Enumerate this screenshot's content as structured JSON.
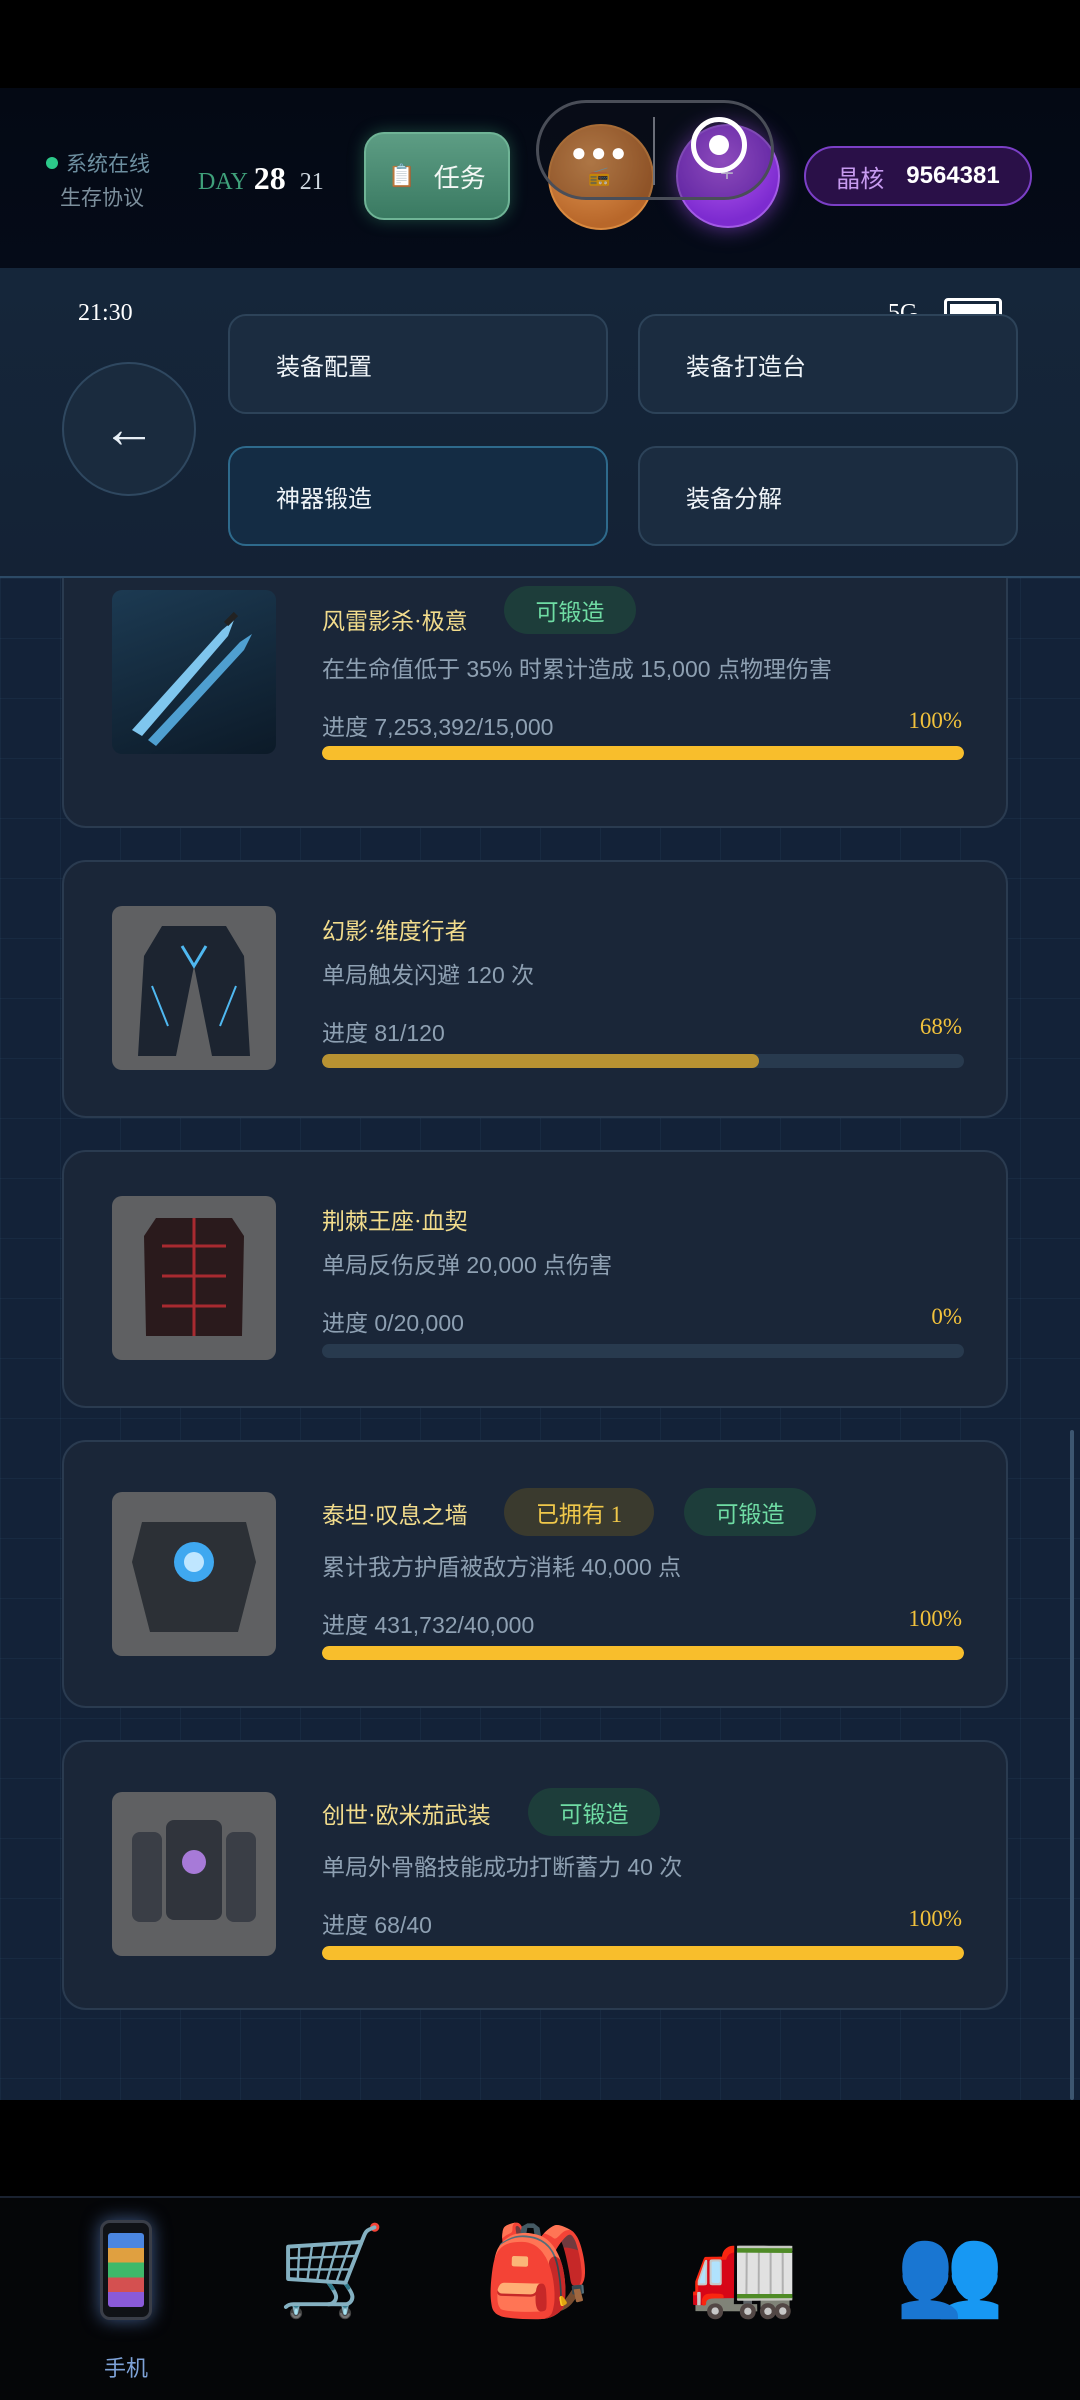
{
  "hud": {
    "online_status": "系统在线",
    "protocol": "生存协议",
    "day_label": "DAY",
    "day_number": "28",
    "day_sub": "21",
    "task_button": "任务",
    "crystal_label": "晶核",
    "crystal_value": "9564381",
    "status_dot_color": "#2cc98a"
  },
  "status_bar": {
    "time": "21:30",
    "network": "5G"
  },
  "nav": {
    "back_glyph": "←",
    "buttons": [
      {
        "label": "装备配置",
        "active": false
      },
      {
        "label": "装备打造台",
        "active": false
      },
      {
        "label": "神器锻造",
        "active": true
      },
      {
        "label": "装备分解",
        "active": false
      }
    ]
  },
  "items": [
    {
      "title": "风雷影杀·极意",
      "tags": [
        "可锻造"
      ],
      "desc": "在生命值低于 35% 时累计造成 15,000 点物理伤害",
      "progress_text": "进度 7,253,392/15,000",
      "percent_text": "100%",
      "percent": 1.0,
      "icon": "twin-blades-icon"
    },
    {
      "title": "幻影·维度行者",
      "tags": [],
      "desc": "单局触发闪避 120 次",
      "progress_text": "进度 81/120",
      "percent_text": "68%",
      "percent": 0.68,
      "icon": "tech-coat-icon"
    },
    {
      "title": "荆棘王座·血契",
      "tags": [],
      "desc": "单局反伤反弹 20,000 点伤害",
      "progress_text": "进度 0/20,000",
      "percent_text": "0%",
      "percent": 0.0,
      "icon": "spiked-vest-icon"
    },
    {
      "title": "泰坦·叹息之墙",
      "tags": [
        "已拥有 1",
        "可锻造"
      ],
      "desc": "累计我方护盾被敌方消耗 40,000 点",
      "progress_text": "进度 431,732/40,000",
      "percent_text": "100%",
      "percent": 1.0,
      "icon": "titan-armor-icon"
    },
    {
      "title": "创世·欧米茄武装",
      "tags": [
        "可锻造"
      ],
      "desc": "单局外骨骼技能成功打断蓄力 40 次",
      "progress_text": "进度 68/40",
      "percent_text": "100%",
      "percent": 1.0,
      "icon": "exoskeleton-icon"
    }
  ],
  "tabbar": {
    "tabs": [
      {
        "label": "手机",
        "icon": "phone-icon"
      },
      {
        "label": "",
        "icon": "cart-icon"
      },
      {
        "label": "",
        "icon": "backpack-icon"
      },
      {
        "label": "",
        "icon": "truck-icon"
      },
      {
        "label": "",
        "icon": "people-icon"
      }
    ]
  },
  "colors": {
    "accent_gold": "#f8be2c",
    "tag_green": "#6fdca4",
    "tag_owned": "#f0c84a"
  }
}
